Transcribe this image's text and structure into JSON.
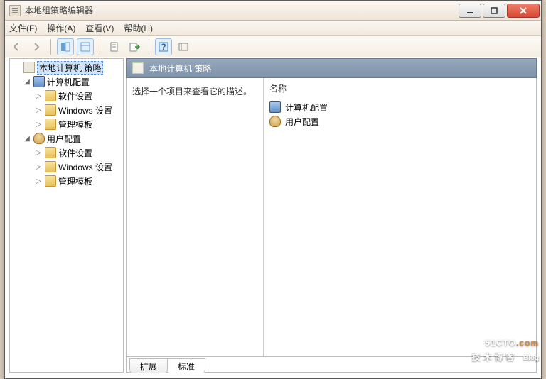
{
  "window": {
    "title": "本地组策略编辑器"
  },
  "menu": {
    "file": "文件(F)",
    "action": "操作(A)",
    "view": "查看(V)",
    "help": "帮助(H)"
  },
  "tree": {
    "root": "本地计算机 策略",
    "computer_config": "计算机配置",
    "user_config": "用户配置",
    "software_settings": "软件设置",
    "windows_settings": "Windows 设置",
    "admin_templates": "管理模板"
  },
  "right_panel": {
    "header": "本地计算机 策略",
    "description_prompt": "选择一个项目来查看它的描述。",
    "column_name": "名称",
    "items": {
      "computer_config": "计算机配置",
      "user_config": "用户配置"
    }
  },
  "tabs": {
    "extended": "扩展",
    "standard": "标准"
  },
  "watermark": {
    "site": "51CTO",
    "dotcom": ".com",
    "tagline": "技术博客",
    "blog": "Blog"
  }
}
